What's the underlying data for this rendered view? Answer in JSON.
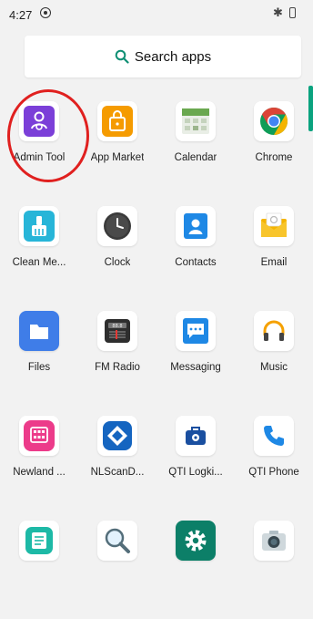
{
  "status_bar": {
    "time": "4:27"
  },
  "search": {
    "label": "Search apps"
  },
  "apps": [
    {
      "label": "Admin Tool",
      "icon": "admin-tool-icon"
    },
    {
      "label": "App Market",
      "icon": "app-market-icon"
    },
    {
      "label": "Calendar",
      "icon": "calendar-icon"
    },
    {
      "label": "Chrome",
      "icon": "chrome-icon"
    },
    {
      "label": "Clean Me...",
      "icon": "clean-icon"
    },
    {
      "label": "Clock",
      "icon": "clock-icon"
    },
    {
      "label": "Contacts",
      "icon": "contacts-icon"
    },
    {
      "label": "Email",
      "icon": "email-icon"
    },
    {
      "label": "Files",
      "icon": "folder-icon"
    },
    {
      "label": "FM Radio",
      "icon": "radio-icon"
    },
    {
      "label": "Messaging",
      "icon": "message-icon"
    },
    {
      "label": "Music",
      "icon": "headphones-icon"
    },
    {
      "label": "Newland ...",
      "icon": "keypad-icon"
    },
    {
      "label": "NLScanD...",
      "icon": "scan-icon"
    },
    {
      "label": "QTI Logki...",
      "icon": "toolbox-icon"
    },
    {
      "label": "QTI Phone",
      "icon": "phone-icon"
    },
    {
      "label": "",
      "icon": "notes-icon"
    },
    {
      "label": "",
      "icon": "magnifier-icon"
    },
    {
      "label": "",
      "icon": "settings-gear-icon"
    },
    {
      "label": "",
      "icon": "camera-icon"
    }
  ],
  "colors": {
    "admin": "#7b3fd8",
    "market": "#f59b00",
    "chrome_red": "#db4437",
    "files": "#3f7de8",
    "messaging": "#1e88e5",
    "music": "#f5a100",
    "newland": "#ec3b8a",
    "qti_phone": "#1e88e5",
    "settings": "#0c7f68",
    "highlight": "#e0201f"
  }
}
